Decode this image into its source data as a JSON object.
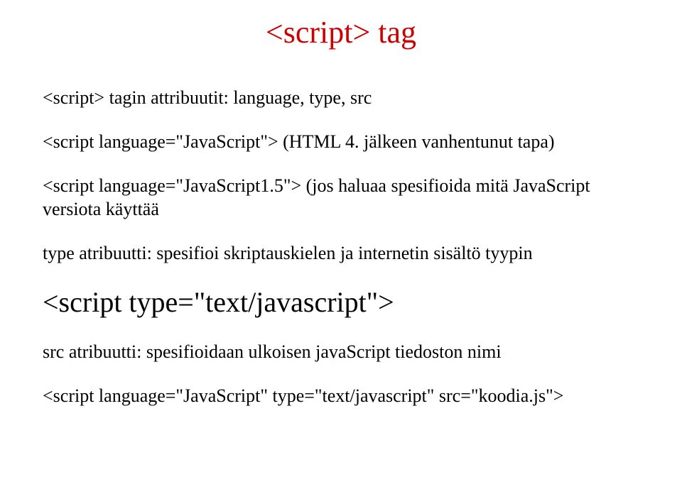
{
  "title": "<script> tag",
  "p1": "<script> tagin attribuutit: language, type, src",
  "p2a": "<script language=\"JavaScript\">  (HTML 4. jälkeen vanhentunut tapa)",
  "p3": "<script language=\"JavaScript1.5\">  (jos haluaa spesifioida mitä JavaScript versiota käyttää",
  "p4": "type atribuutti: spesifioi skriptauskielen ja internetin sisältö tyypin",
  "bigline": "<script   type=\"text/javascript\">",
  "p5": "src atribuutti: spesifioidaan ulkoisen javaScript tiedoston nimi",
  "p6": "<script language=\"JavaScript\" type=\"text/javascript\" src=\"koodia.js\">"
}
